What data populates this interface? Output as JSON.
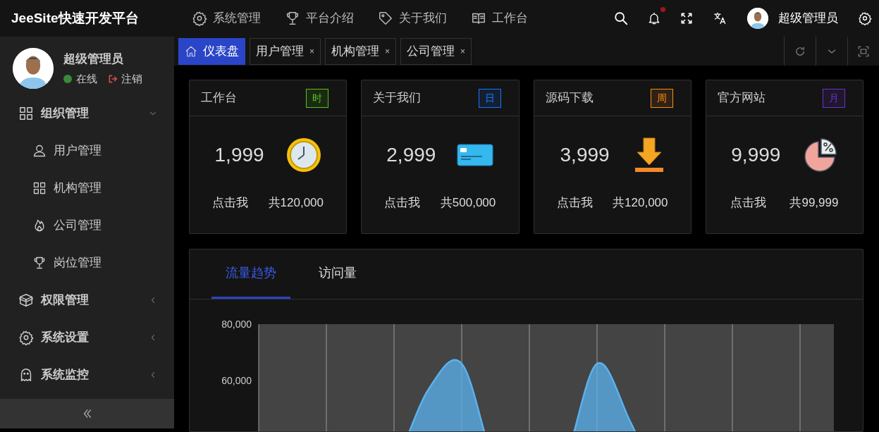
{
  "brand": "JeeSite快速开发平台",
  "top_menu": [
    {
      "label": "系统管理"
    },
    {
      "label": "平台介绍"
    },
    {
      "label": "关于我们"
    },
    {
      "label": "工作台"
    }
  ],
  "notifications": {
    "unread": true
  },
  "user": {
    "name": "超级管理员"
  },
  "sidebar": {
    "user_name": "超级管理员",
    "status": "在线",
    "logout": "注销",
    "menu": [
      {
        "label": "组织管理",
        "expanded": true,
        "children": [
          {
            "label": "用户管理"
          },
          {
            "label": "机构管理"
          },
          {
            "label": "公司管理"
          },
          {
            "label": "岗位管理"
          }
        ]
      },
      {
        "label": "权限管理",
        "expanded": false
      },
      {
        "label": "系统设置",
        "expanded": false
      },
      {
        "label": "系统监控",
        "expanded": false
      }
    ]
  },
  "tabs": [
    {
      "label": "仪表盘",
      "selected": true
    },
    {
      "label": "用户管理",
      "selected": false,
      "close": "×"
    },
    {
      "label": "机构管理",
      "selected": false,
      "close": "×"
    },
    {
      "label": "公司管理",
      "selected": false,
      "close": "×"
    }
  ],
  "stat_cards": [
    {
      "title": "工作台",
      "badge": "时",
      "color": "#52c41a",
      "value": "1,999",
      "link": "点击我",
      "total": "共120,000"
    },
    {
      "title": "关于我们",
      "badge": "日",
      "color": "#1677ff",
      "value": "2,999",
      "link": "点击我",
      "total": "共500,000"
    },
    {
      "title": "源码下载",
      "badge": "周",
      "color": "#fa8c16",
      "value": "3,999",
      "link": "点击我",
      "total": "共120,000"
    },
    {
      "title": "官方网站",
      "badge": "月",
      "color": "#722ed1",
      "value": "9,999",
      "link": "点击我",
      "total": "共99,999"
    }
  ],
  "chart_panel": {
    "tabs": [
      {
        "label": "流量趋势",
        "selected": true
      },
      {
        "label": "访问量",
        "selected": false
      }
    ],
    "chart_data": {
      "type": "area",
      "grid": true,
      "ylim": [
        0,
        80000
      ],
      "yticks": [
        {
          "value": 60000,
          "label": "60,000"
        },
        {
          "value": 80000,
          "label": "80,000"
        }
      ],
      "series": [
        {
          "color": "#5ab1ef",
          "values": [
            20000,
            20000,
            20000,
            20000,
            30000,
            56500,
            66000,
            30000,
            20000,
            30000,
            66000,
            45000,
            20000,
            20000,
            20000,
            20000,
            20000,
            20000
          ]
        }
      ]
    }
  }
}
